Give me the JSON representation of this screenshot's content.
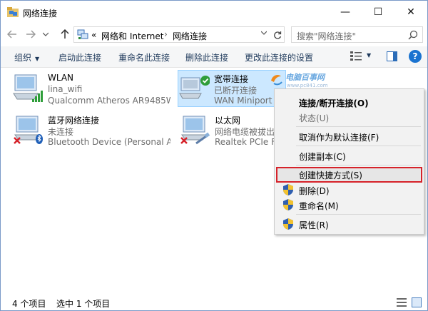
{
  "window": {
    "title": "网络连接",
    "controls": {
      "minimize": "—",
      "maximize": "☐",
      "close": "✕"
    }
  },
  "address_bar": {
    "prefix": "«",
    "crumbs": [
      "网络和 Internet",
      "网络连接"
    ],
    "separator": "›",
    "search_placeholder": "搜索\"网络连接\""
  },
  "command_bar": {
    "organize": "组织",
    "commands": [
      "启动此连接",
      "重命名此连接",
      "删除此连接",
      "更改此连接的设置"
    ],
    "help": "?"
  },
  "connections": [
    {
      "name": "WLAN",
      "status": "lina_wifi",
      "device": "Qualcomm Atheros AR9485W...",
      "icon": "wifi-adapter-icon",
      "selected": false
    },
    {
      "name": "宽带连接",
      "status": "已断开连接",
      "device": "WAN Miniport (",
      "icon": "broadband-connection-icon",
      "selected": true
    },
    {
      "name": "蓝牙网络连接",
      "status": "未连接",
      "device": "Bluetooth Device (Personal Ar...",
      "icon": "bluetooth-adapter-icon",
      "selected": false
    },
    {
      "name": "以太网",
      "status": "网络电缆被拔出",
      "device": "Realtek PCIe FE",
      "icon": "ethernet-adapter-icon",
      "selected": false
    }
  ],
  "watermark": {
    "text": "电脑百事网",
    "url": "www.pc841.com"
  },
  "context_menu": {
    "items": [
      {
        "label": "连接/断开连接(O)",
        "bold": true,
        "disabled": false,
        "shield": false
      },
      {
        "label": "状态(U)",
        "bold": false,
        "disabled": true,
        "shield": false
      },
      {
        "label": "取消作为默认连接(F)",
        "bold": false,
        "disabled": false,
        "shield": false
      },
      {
        "label": "创建副本(C)",
        "bold": false,
        "disabled": false,
        "shield": false
      },
      {
        "label": "创建快捷方式(S)",
        "bold": false,
        "disabled": false,
        "shield": false,
        "highlighted": true
      },
      {
        "label": "删除(D)",
        "bold": false,
        "disabled": false,
        "shield": true
      },
      {
        "label": "重命名(M)",
        "bold": false,
        "disabled": false,
        "shield": true
      },
      {
        "label": "属性(R)",
        "bold": false,
        "disabled": false,
        "shield": true
      }
    ]
  },
  "status_bar": {
    "item_count": "4 个项目",
    "selected_count": "选中 1 个项目"
  },
  "colors": {
    "selection_bg": "#cce8ff",
    "highlight_border": "#d6222a",
    "command_text": "#1e395b",
    "help_blue": "#1a73d0"
  }
}
